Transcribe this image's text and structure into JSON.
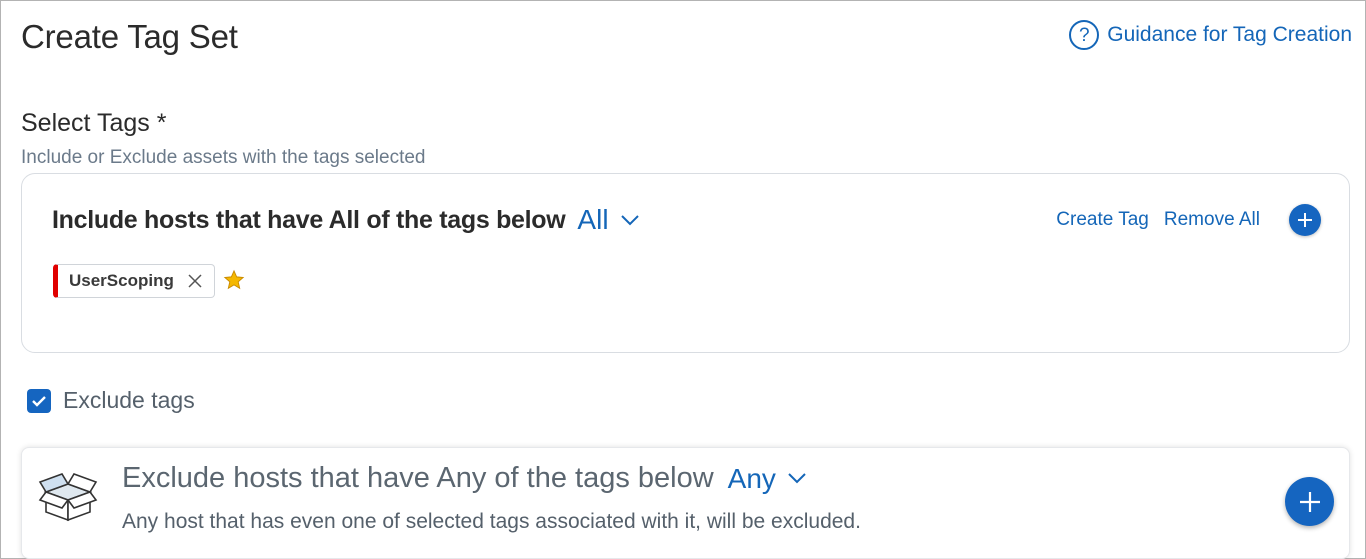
{
  "page": {
    "title": "Create Tag Set",
    "guidance_link": "Guidance for Tag Creation",
    "guidance_icon": "help-circle-icon"
  },
  "select_tags": {
    "title": "Select Tags *",
    "subtitle": "Include or Exclude assets with the tags selected"
  },
  "include": {
    "title": "Include hosts that have All of the tags below",
    "mode": "All",
    "actions": {
      "create_tag": "Create Tag",
      "remove_all": "Remove All"
    },
    "tags": [
      {
        "label": "UserScoping",
        "color": "#e00000",
        "favorite": true
      }
    ]
  },
  "exclude": {
    "checkbox_label": "Exclude tags",
    "checked": true,
    "title": "Exclude hosts that have Any of the tags below",
    "mode": "Any",
    "description": "Any host that has even one of selected tags associated with it, will be excluded.",
    "icon": "open-box-icon"
  },
  "colors": {
    "accent": "#1466b8",
    "button": "#1565c0",
    "tag_marker": "#e00000",
    "star": "#f5b800"
  }
}
